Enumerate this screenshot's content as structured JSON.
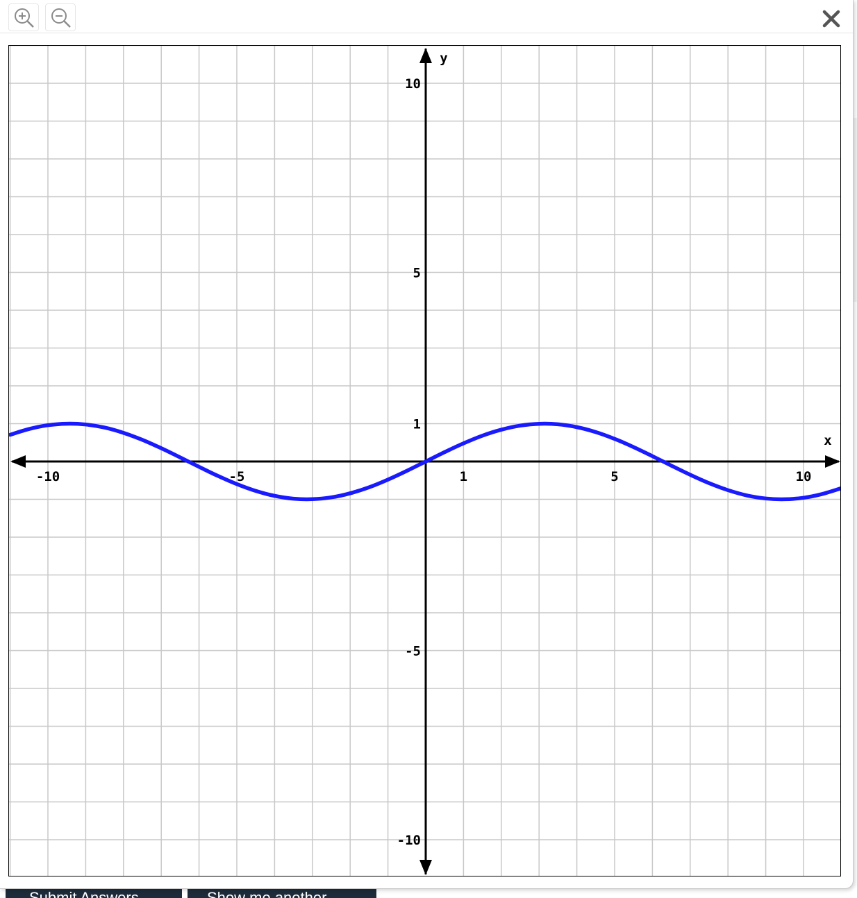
{
  "toolbar": {
    "zoom_in_icon": "zoom-in-icon",
    "zoom_out_icon": "zoom-out-icon",
    "close_icon": "close-icon"
  },
  "background_buttons": {
    "submit_label": "Submit Answers",
    "another_label": "Show me another"
  },
  "chart_data": {
    "type": "line",
    "x_axis_label": "x",
    "y_axis_label": "y",
    "xlim": [
      -11,
      11
    ],
    "ylim": [
      -11,
      11
    ],
    "grid": true,
    "grid_step": 1,
    "x_tick_labels": [
      {
        "value": -10,
        "label": "-10"
      },
      {
        "value": -5,
        "label": "-5"
      },
      {
        "value": 1,
        "label": "1"
      },
      {
        "value": 5,
        "label": "5"
      },
      {
        "value": 10,
        "label": "10"
      }
    ],
    "y_tick_labels": [
      {
        "value": 10,
        "label": "10"
      },
      {
        "value": 5,
        "label": "5"
      },
      {
        "value": 1,
        "label": "1"
      },
      {
        "value": -5,
        "label": "-5"
      },
      {
        "value": -10,
        "label": "-10"
      }
    ],
    "series": [
      {
        "function": "sin(x/2)",
        "color": "#1a1aff",
        "x": [
          -11,
          -10.5,
          -10,
          -9.5,
          -9,
          -8.5,
          -8,
          -7.5,
          -7,
          -6.5,
          -6,
          -5.5,
          -5,
          -4.5,
          -4,
          -3.5,
          -3,
          -2.5,
          -2,
          -1.5,
          -1,
          -0.5,
          0,
          0.5,
          1,
          1.5,
          2,
          2.5,
          3,
          3.5,
          4,
          4.5,
          5,
          5.5,
          6,
          6.5,
          7,
          7.5,
          8,
          8.5,
          9,
          9.5,
          10,
          10.5,
          11
        ],
        "y": [
          0.706,
          0.859,
          0.959,
          0.999,
          0.978,
          0.898,
          0.757,
          0.572,
          0.351,
          0.108,
          -0.141,
          -0.382,
          -0.598,
          -0.778,
          -0.909,
          -0.984,
          -0.997,
          -0.949,
          -0.841,
          -0.682,
          -0.479,
          -0.247,
          0,
          0.247,
          0.479,
          0.682,
          0.841,
          0.949,
          0.997,
          0.984,
          0.909,
          0.778,
          0.598,
          0.382,
          0.141,
          -0.108,
          -0.351,
          -0.572,
          -0.757,
          -0.898,
          -0.978,
          -0.999,
          -0.959,
          -0.859,
          -0.706
        ]
      }
    ]
  },
  "colors": {
    "curve": "#1a1aff",
    "grid": "#c8c8c8",
    "axes": "#000000",
    "button_bg": "#1d2b3a"
  }
}
